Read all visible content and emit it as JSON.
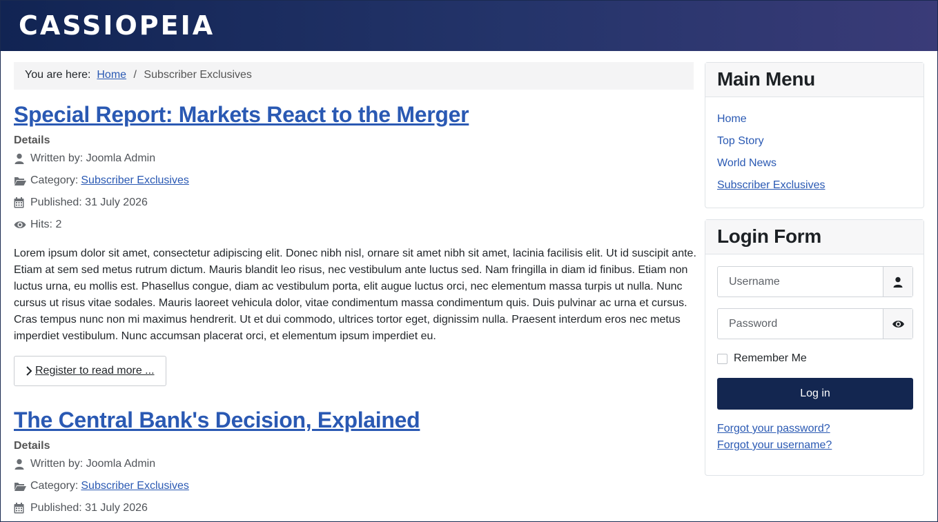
{
  "site": {
    "brand": "CASSIOPEIA"
  },
  "breadcrumb": {
    "prefix": "You are here:",
    "home": "Home",
    "separator": "/",
    "current": "Subscriber Exclusives"
  },
  "articles": [
    {
      "title": "Special Report: Markets React to the Merger",
      "details_label": "Details",
      "written_by": "Written by: Joomla Admin",
      "category_label": "Category:",
      "category": "Subscriber Exclusives",
      "published": "Published: 31 July 2026",
      "hits": "Hits: 2",
      "intro": "Lorem ipsum dolor sit amet, consectetur adipiscing elit. Donec nibh nisl, ornare sit amet nibh sit amet, lacinia facilisis elit. Ut id suscipit ante. Etiam at sem sed metus rutrum dictum. Mauris blandit leo risus, nec vestibulum ante luctus sed. Nam fringilla in diam id finibus. Etiam non luctus urna, eu mollis est. Phasellus congue, diam ac vestibulum porta, elit augue luctus orci, nec elementum massa turpis ut nulla. Nunc cursus ut risus vitae sodales. Mauris laoreet vehicula dolor, vitae condimentum massa condimentum quis. Duis pulvinar ac urna et cursus. Cras tempus nunc non mi maximus hendrerit. Ut et dui commodo, ultrices tortor eget, dignissim nulla. Praesent interdum eros nec metus imperdiet vestibulum. Nunc accumsan placerat orci, et elementum ipsum imperdiet eu.",
      "readmore": "Register to read more ..."
    },
    {
      "title": "The Central Bank's Decision, Explained",
      "details_label": "Details",
      "written_by": "Written by: Joomla Admin",
      "category_label": "Category:",
      "category": "Subscriber Exclusives",
      "published": "Published: 31 July 2026"
    }
  ],
  "main_menu": {
    "title": "Main Menu",
    "items": [
      "Home",
      "Top Story",
      "World News",
      "Subscriber Exclusives"
    ]
  },
  "login_form": {
    "title": "Login Form",
    "username_placeholder": "Username",
    "password_placeholder": "Password",
    "remember_label": "Remember Me",
    "login_button": "Log in",
    "forgot_password": "Forgot your password?",
    "forgot_username": "Forgot your username?"
  },
  "icons": {
    "user": "user-icon",
    "folder": "folder-icon",
    "calendar": "calendar-icon",
    "eye": "eye-icon",
    "chevron": "chevron-right-icon"
  },
  "colors": {
    "header_start": "#112453",
    "header_end": "#3a3b78",
    "link": "#2a59b3",
    "button": "#132650"
  }
}
